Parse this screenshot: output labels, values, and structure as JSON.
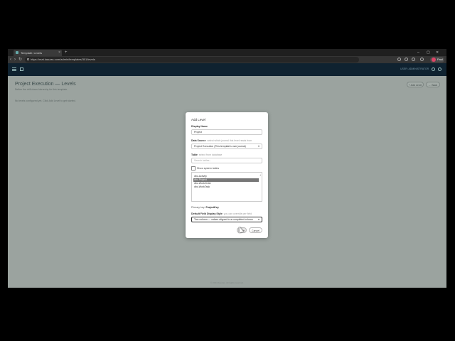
{
  "browser": {
    "tab_title": "Template: Levels",
    "new_tab": "+",
    "url": "https://mat.kaozas.com/admin/templates/301/levels",
    "window_controls": [
      "⌄",
      "–",
      "▢",
      "✕"
    ],
    "profile_label": "Paul"
  },
  "app": {
    "header_text": "USER: ADMINISTRATOR"
  },
  "page": {
    "title": "Project Execution — Levels",
    "subtitle": "Define the drill-down hierarchy for this template.",
    "empty_state": "No levels configured yet. Click Add Level to get started.",
    "add_level_label": "+ Add Level",
    "back_label": "← Back",
    "footer": "© 2024 Kaozas. All rights reserved."
  },
  "modal": {
    "title": "Add Level",
    "display_name": {
      "label": "Display Name",
      "value": "Project"
    },
    "data_source": {
      "label": "Data Source",
      "hint": "select which journal this level reads from",
      "value": "Project Execution (This template's own journal)"
    },
    "table": {
      "label": "Table",
      "hint": "select from database",
      "placeholder": "Search tables..."
    },
    "show_system_label": "Show system tables",
    "tables": [
      {
        "name": "dbo.Activity",
        "selected": false
      },
      {
        "name": "dbo.Project",
        "selected": true
      },
      {
        "name": "dbo.WorkOrder",
        "selected": false
      },
      {
        "name": "dbo.WorkTask",
        "selected": false
      }
    ],
    "primary_key_label": "Primary key:",
    "primary_key_value": "ProjectKey",
    "display_style": {
      "label": "Default Field Display Style",
      "hint": "you can override per field",
      "value": "Two column — values aligned to a completed column"
    },
    "save_label": "Save",
    "cancel_label": "Cancel"
  }
}
